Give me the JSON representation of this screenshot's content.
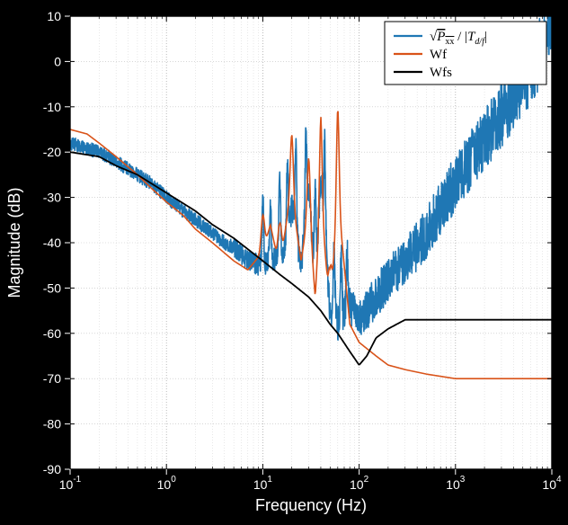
{
  "chart_data": {
    "type": "line",
    "title": "",
    "xlabel": "Frequency (Hz)",
    "ylabel": "Magnitude (dB)",
    "xscale": "log",
    "xlim": [
      0.1,
      10000.0
    ],
    "ylim": [
      -90,
      10
    ],
    "xticks": [
      0.1,
      1.0,
      10.0,
      100.0,
      1000.0,
      10000.0
    ],
    "yticks": [
      -90,
      -80,
      -70,
      -60,
      -50,
      -40,
      -30,
      -20,
      -10,
      0,
      10
    ],
    "grid": true,
    "legend_position": "top-right",
    "series": [
      {
        "name": "sqrt(Pxx)/|T_d/f|",
        "color": "#1f77b4",
        "x": [
          0.1,
          0.2,
          0.3,
          0.5,
          0.7,
          1.0,
          1.5,
          2.0,
          3.0,
          4.0,
          5.0,
          7.0,
          10,
          12,
          15,
          18,
          20,
          25,
          30,
          35,
          40,
          50,
          60,
          80,
          100,
          150,
          200,
          300,
          500,
          800,
          1000,
          1500,
          2000,
          3000,
          5000,
          8000,
          10000
        ],
        "y": [
          -18,
          -20,
          -22,
          -25,
          -27,
          -30,
          -33,
          -35,
          -38,
          -40,
          -41,
          -44,
          -45,
          -44,
          -43,
          -40,
          -32,
          -45,
          -28,
          -50,
          -25,
          -55,
          -58,
          -54,
          -57,
          -52,
          -48,
          -44,
          -38,
          -30,
          -27,
          -21,
          -17,
          -12,
          -5,
          3,
          9
        ]
      },
      {
        "name": "Wf",
        "color": "#d95319",
        "x": [
          0.1,
          0.15,
          0.2,
          0.3,
          0.5,
          0.7,
          1.0,
          1.5,
          2.0,
          3.0,
          5.0,
          7.0,
          10,
          12,
          15,
          18,
          20,
          25,
          30,
          35,
          40,
          50,
          60,
          80,
          100,
          150,
          200,
          300,
          500,
          1000,
          3000,
          10000
        ],
        "y": [
          -15,
          -16,
          -18,
          -21,
          -25,
          -28,
          -31,
          -34,
          -37,
          -40,
          -44,
          -46,
          -42,
          -36,
          -46,
          -34,
          -30,
          -44,
          -33,
          -52,
          -30,
          -56,
          -30,
          -58,
          -62,
          -65,
          -67,
          -68,
          -69,
          -70,
          -70,
          -70
        ]
      },
      {
        "name": "Wfs",
        "color": "#000000",
        "x": [
          0.1,
          0.2,
          0.3,
          0.5,
          1.0,
          2.0,
          3.0,
          5.0,
          10,
          15,
          20,
          30,
          40,
          50,
          60,
          80,
          100,
          120,
          150,
          200,
          300,
          500,
          1000,
          3000,
          10000
        ],
        "y": [
          -20,
          -21,
          -23,
          -25,
          -29,
          -33,
          -36,
          -39,
          -44,
          -47,
          -49,
          -52,
          -55,
          -58,
          -60,
          -64,
          -67,
          -65,
          -61,
          -59,
          -57,
          -57,
          -57,
          -57,
          -57
        ]
      }
    ],
    "noise_band": {
      "series_index": 0,
      "x_start": 5,
      "amp_db_start": 2,
      "amp_db_end": 8
    },
    "spikes": {
      "series_index": 0,
      "x": [
        10,
        12,
        15,
        18,
        22,
        28,
        35,
        44,
        55,
        65,
        75
      ],
      "height_db": [
        15,
        13,
        17,
        18,
        20,
        19,
        22,
        20,
        15,
        14,
        12
      ]
    }
  },
  "legend": {
    "items": [
      {
        "swatch": "#1f77b4",
        "label_html": "√<span style=\"text-decoration:overline\">P<sub>xx</sub></span> / |T<sub>d/f</sub>|"
      },
      {
        "swatch": "#d95319",
        "label": "Wf"
      },
      {
        "swatch": "#000000",
        "label": "Wfs"
      }
    ]
  },
  "axes": {
    "x": {
      "label": "Frequency (Hz)"
    },
    "y": {
      "label": "Magnitude (dB)"
    }
  }
}
